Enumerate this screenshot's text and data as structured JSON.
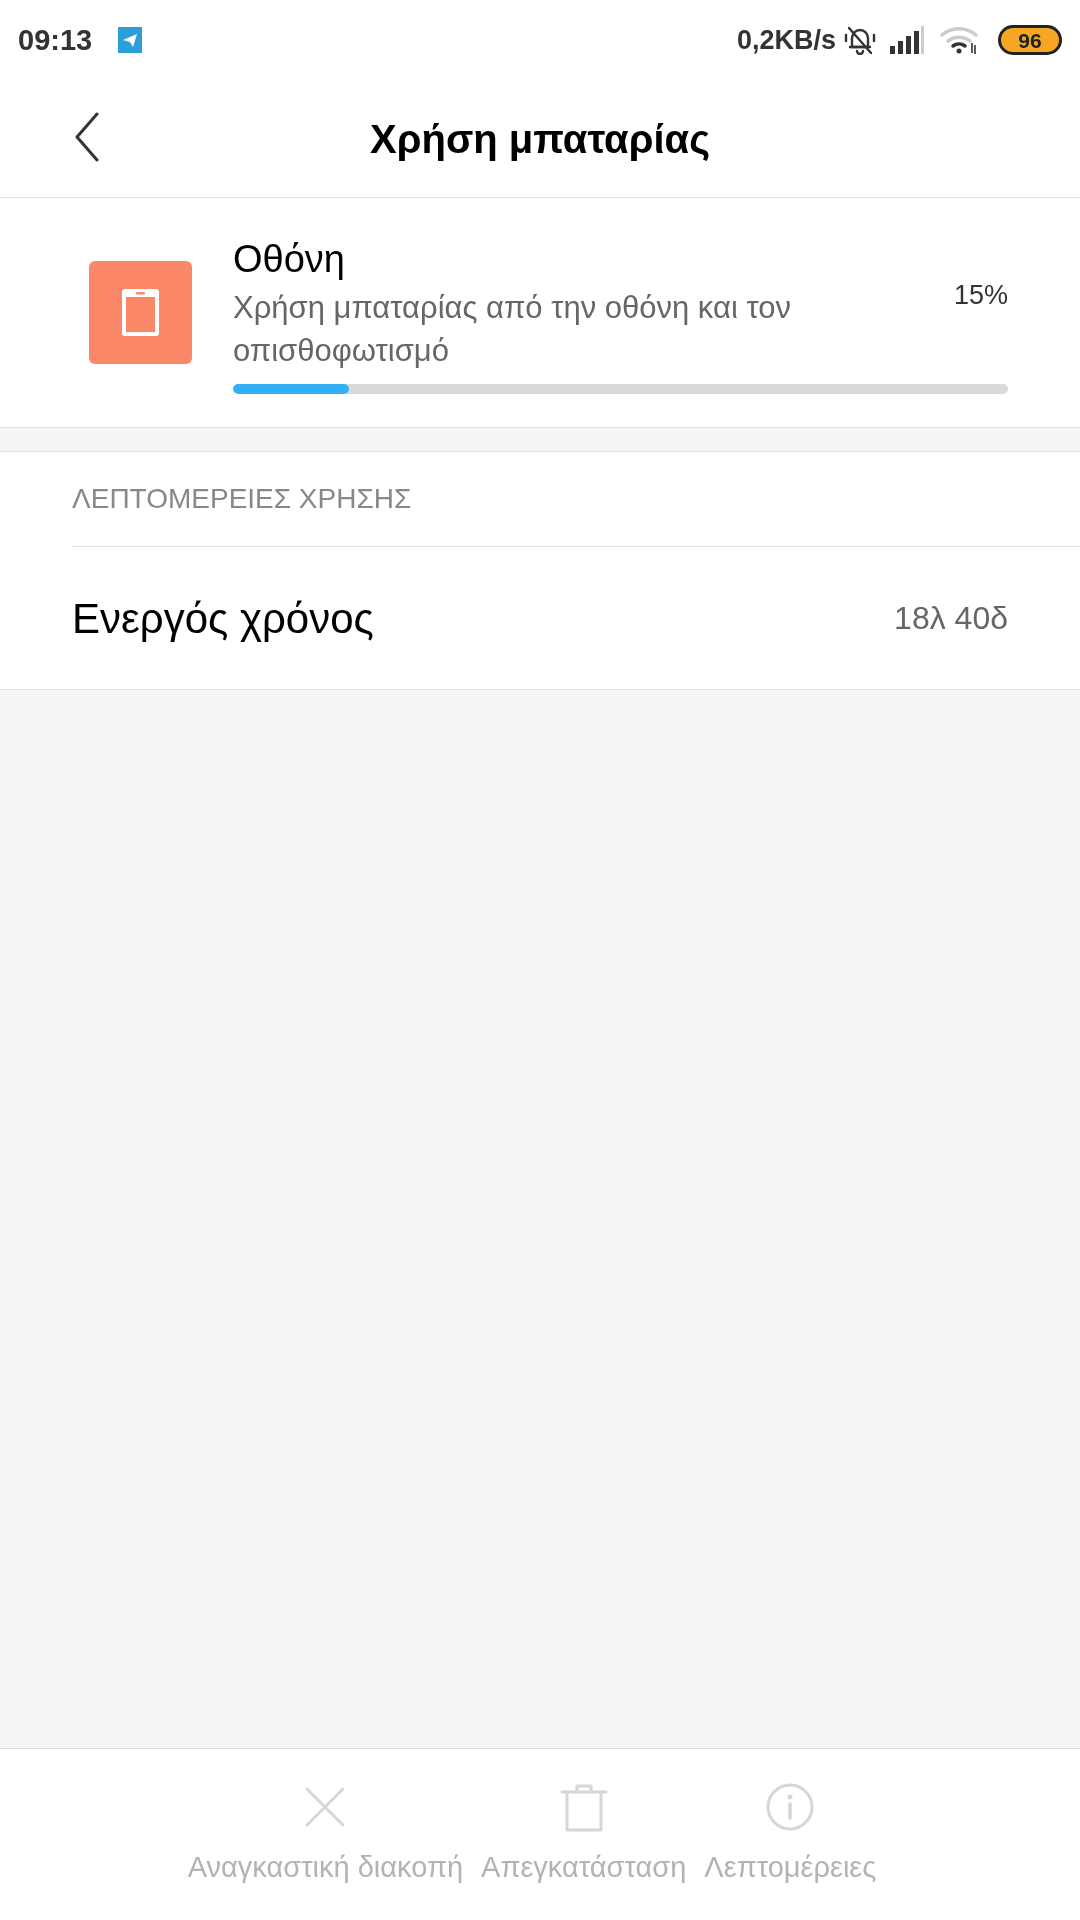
{
  "status_bar": {
    "time": "09:13",
    "network_speed": "0,2KB/s",
    "battery": "96"
  },
  "header": {
    "title": "Χρήση μπαταρίας"
  },
  "app_usage": {
    "name": "Οθόνη",
    "description": "Χρήση μπαταρίας από την οθόνη και τον οπισθοφωτισμό",
    "percent": "15%",
    "level": 0.15
  },
  "usage_details": {
    "heading": "ΛΕΠΤΟΜΕΡΕΙΕΣ ΧΡΗΣΗΣ",
    "rows": [
      {
        "label": "Ενεργός χρόνος",
        "value": "18λ 40δ"
      }
    ]
  },
  "actions": [
    {
      "kind": "force_stop",
      "label": "Αναγκαστική διακοπή",
      "disabled": true
    },
    {
      "kind": "uninstall",
      "label": "Απεγκατάσταση",
      "disabled": true
    },
    {
      "kind": "details",
      "label": "Λεπτομέρειες",
      "disabled": true
    }
  ]
}
